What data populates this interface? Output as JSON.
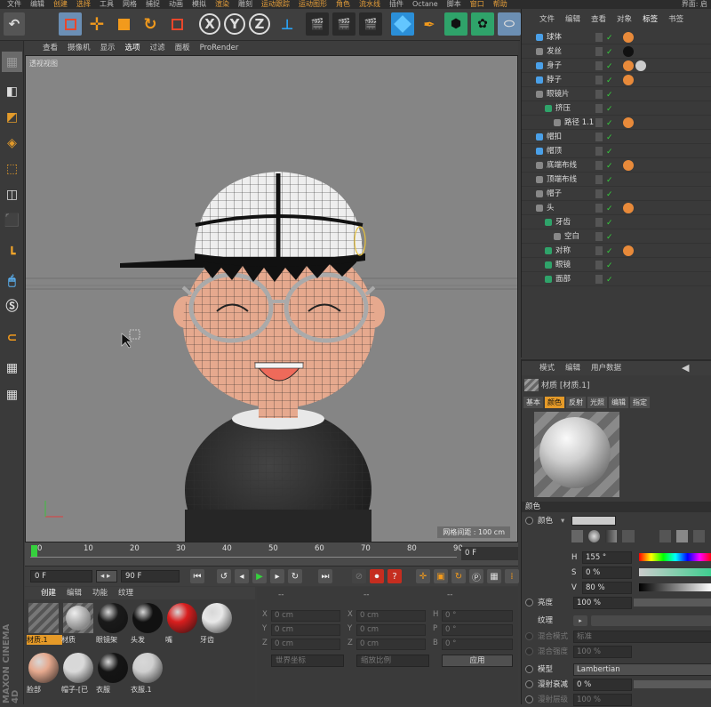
{
  "menubar": [
    "文件",
    "编辑",
    "创建",
    "选择",
    "工具",
    "网格",
    "捕捉",
    "动画",
    "模拟",
    "渲染",
    "雕刻",
    "运动跟踪",
    "运动图形",
    "角色",
    "流水线",
    "插件",
    "Octane",
    "脚本",
    "窗口",
    "帮助"
  ],
  "menubar_accent_indices": [
    2,
    3,
    9,
    11,
    12,
    13,
    14,
    18,
    19
  ],
  "menubar_right": "界面: 启",
  "toolbar": {
    "undo_icon": "undo-icon",
    "axis_labels": [
      "X",
      "Y",
      "Z"
    ]
  },
  "viewport": {
    "menu": [
      "查看",
      "摄像机",
      "显示",
      "选项",
      "过滤",
      "面板",
      "ProRender"
    ],
    "label": "透视视图",
    "grid_info": "网格间距 : 100 cm",
    "background": "#858585"
  },
  "timeline": {
    "ticks": [
      "0",
      "10",
      "20",
      "30",
      "40",
      "50",
      "60",
      "70",
      "80",
      "90"
    ],
    "current_frame_display": "0 F",
    "start_field": "0 F",
    "end_field": "90 F",
    "start_marker": "0"
  },
  "materials": {
    "menu": [
      "创建",
      "编辑",
      "功能",
      "纹理"
    ],
    "items": [
      {
        "label": "材质.1",
        "color": "#8a8a8a",
        "selected": true
      },
      {
        "label": "材质",
        "color": "#aaaaaa",
        "selected": false
      },
      {
        "label": "眼镜架",
        "color": "#1a1a1a",
        "selected": false
      },
      {
        "label": "头发",
        "color": "#111111",
        "selected": false
      },
      {
        "label": "嘴",
        "color": "#d91e1e",
        "selected": false
      },
      {
        "label": "牙齿",
        "color": "#e8e8e8",
        "selected": false
      },
      {
        "label": "脸部",
        "color": "#e6a98e",
        "selected": false
      },
      {
        "label": "帽子-[已",
        "color": "#d9d9d9",
        "selected": false
      },
      {
        "label": "衣服",
        "color": "#141414",
        "selected": false
      },
      {
        "label": "衣服.1",
        "color": "#cfcfcf",
        "selected": false
      }
    ]
  },
  "coords": {
    "header": "--",
    "rows": [
      {
        "a": "X",
        "av": "0 cm",
        "b": "X",
        "bv": "0 cm",
        "c": "H",
        "cv": "0 °"
      },
      {
        "a": "Y",
        "av": "0 cm",
        "b": "Y",
        "bv": "0 cm",
        "c": "P",
        "cv": "0 °"
      },
      {
        "a": "Z",
        "av": "0 cm",
        "b": "Z",
        "bv": "0 cm",
        "c": "B",
        "cv": "0 °"
      }
    ],
    "world_select": "世界坐标",
    "scale_select": "缩放比例",
    "apply_button": "应用"
  },
  "objects": {
    "tabs": [
      "文件",
      "编辑",
      "查看",
      "对象",
      "标签",
      "书签"
    ],
    "rows": [
      {
        "name": "球体",
        "indent": 18
      },
      {
        "name": "发丝",
        "indent": 18
      },
      {
        "name": "身子",
        "indent": 18
      },
      {
        "name": "脖子",
        "indent": 18
      },
      {
        "name": "眼镜片",
        "indent": 18
      },
      {
        "name": "挤压",
        "indent": 28
      },
      {
        "name": "路径 1.1",
        "indent": 38
      },
      {
        "name": "帽扣",
        "indent": 18
      },
      {
        "name": "帽顶",
        "indent": 18
      },
      {
        "name": "底端布线",
        "indent": 18
      },
      {
        "name": "顶端布线",
        "indent": 18
      },
      {
        "name": "帽子",
        "indent": 18
      },
      {
        "name": "头",
        "indent": 18
      },
      {
        "name": "牙齿",
        "indent": 28
      },
      {
        "name": "空白",
        "indent": 38
      },
      {
        "name": "对称",
        "indent": 28
      },
      {
        "name": "眼镜",
        "indent": 28
      },
      {
        "name": "面部",
        "indent": 28
      }
    ]
  },
  "attributes": {
    "menu": [
      "模式",
      "编辑",
      "用户数据"
    ],
    "title": "材质 [材质.1]",
    "tabs": [
      "基本",
      "颜色",
      "反射",
      "光照",
      "编辑",
      "指定"
    ],
    "active_tab": 1,
    "section_color": "颜色",
    "color_label": "颜色",
    "h_label": "H",
    "h_value": "155 °",
    "s_label": "S",
    "s_value": "0 %",
    "v_label": "V",
    "v_value": "80 %",
    "brightness_label": "亮度",
    "brightness_value": "100 %",
    "texture_label": "纹理",
    "mix_mode_label": "混合模式",
    "mix_mode_value": "标准",
    "mix_strength_label": "混合强度",
    "mix_strength_value": "100 %",
    "model_label": "模型",
    "model_value": "Lambertian",
    "diffuse_falloff_label": "漫射衰减",
    "diffuse_falloff_value": "0 %",
    "diffuse_level_label": "漫射层级",
    "diffuse_level_value": "100 %",
    "swatch_color": "#cccccc"
  },
  "brand": {
    "line1": "MAXON",
    "line2": "CINEMA 4D"
  }
}
